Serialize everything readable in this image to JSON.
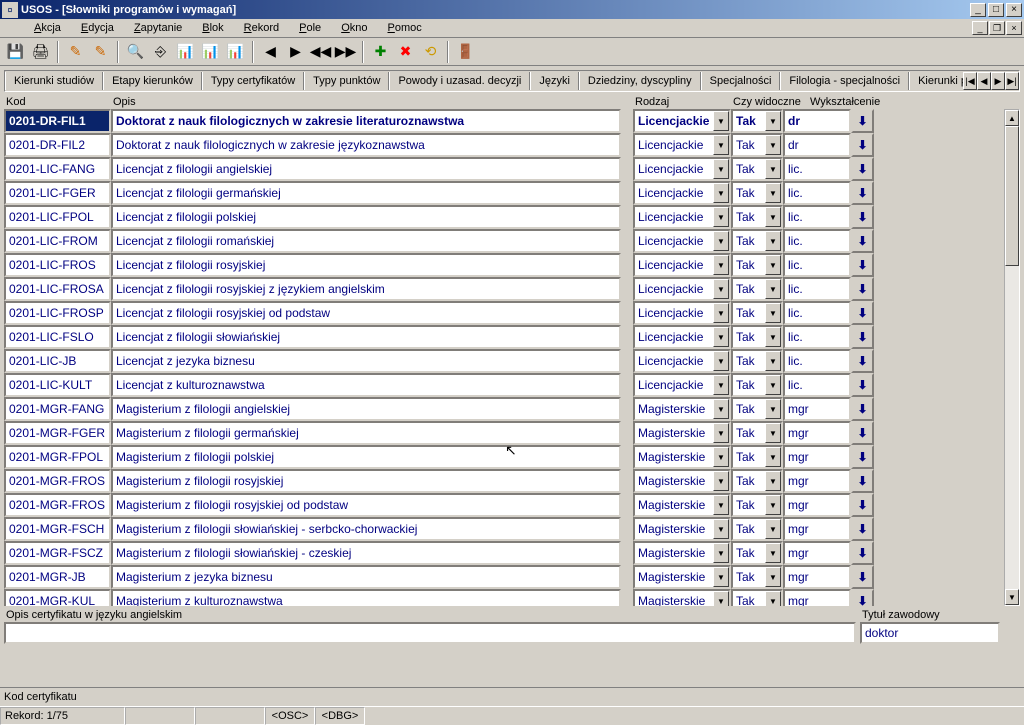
{
  "window": {
    "title": "USOS - [Słowniki programów i wymagań]"
  },
  "menu": {
    "items": [
      "Akcja",
      "Edycja",
      "Zapytanie",
      "Blok",
      "Rekord",
      "Pole",
      "Okno",
      "Pomoc"
    ]
  },
  "tabs": {
    "items": [
      "Kierunki studiów",
      "Etapy kierunków",
      "Typy certyfikatów",
      "Typy punktów",
      "Powody i uzasad. decyzji",
      "Języki",
      "Dziedziny, dyscypliny",
      "Specjalności",
      "Filologia - specjalności",
      "Kierunki pr"
    ],
    "active_index": 2
  },
  "columns": {
    "kod": "Kod",
    "opis": "Opis",
    "rodzaj": "Rodzaj",
    "czy": "Czy widoczne",
    "wyk": "Wykształcenie"
  },
  "rows": [
    {
      "kod": "0201-DR-FIL1",
      "opis": "Doktorat z nauk filologicznych w zakresie literaturoznawstwa",
      "rodzaj": "Licencjackie",
      "czy": "Tak",
      "wyk": "dr",
      "selected": true,
      "bold": true
    },
    {
      "kod": "0201-DR-FIL2",
      "opis": "Doktorat z nauk filologicznych w zakresie językoznawstwa",
      "rodzaj": "Licencjackie",
      "czy": "Tak",
      "wyk": "dr"
    },
    {
      "kod": "0201-LIC-FANG",
      "opis": "Licencjat z filologii angielskiej",
      "rodzaj": "Licencjackie",
      "czy": "Tak",
      "wyk": "lic."
    },
    {
      "kod": "0201-LIC-FGER",
      "opis": "Licencjat z filologii germańskiej",
      "rodzaj": "Licencjackie",
      "czy": "Tak",
      "wyk": "lic."
    },
    {
      "kod": "0201-LIC-FPOL",
      "opis": "Licencjat z filologii polskiej",
      "rodzaj": "Licencjackie",
      "czy": "Tak",
      "wyk": "lic."
    },
    {
      "kod": "0201-LIC-FROM",
      "opis": "Licencjat z filologii romańskiej",
      "rodzaj": "Licencjackie",
      "czy": "Tak",
      "wyk": "lic."
    },
    {
      "kod": "0201-LIC-FROS",
      "opis": "Licencjat z filologii rosyjskiej",
      "rodzaj": "Licencjackie",
      "czy": "Tak",
      "wyk": "lic."
    },
    {
      "kod": "0201-LIC-FROSA",
      "opis": "Licencjat z filologii rosyjskiej z językiem angielskim",
      "rodzaj": "Licencjackie",
      "czy": "Tak",
      "wyk": "lic."
    },
    {
      "kod": "0201-LIC-FROSP",
      "opis": "Licencjat z filologii rosyjskiej od podstaw",
      "rodzaj": "Licencjackie",
      "czy": "Tak",
      "wyk": "lic."
    },
    {
      "kod": "0201-LIC-FSLO",
      "opis": "Licencjat z filologii słowiańskiej",
      "rodzaj": "Licencjackie",
      "czy": "Tak",
      "wyk": "lic."
    },
    {
      "kod": "0201-LIC-JB",
      "opis": "Licencjat z jezyka biznesu",
      "rodzaj": "Licencjackie",
      "czy": "Tak",
      "wyk": "lic."
    },
    {
      "kod": "0201-LIC-KULT",
      "opis": "Licencjat z kulturoznawstwa",
      "rodzaj": "Licencjackie",
      "czy": "Tak",
      "wyk": "lic."
    },
    {
      "kod": "0201-MGR-FANG",
      "opis": "Magisterium z filologii angielskiej",
      "rodzaj": "Magisterskie",
      "czy": "Tak",
      "wyk": "mgr"
    },
    {
      "kod": "0201-MGR-FGER",
      "opis": "Magisterium z filologii germańskiej",
      "rodzaj": "Magisterskie",
      "czy": "Tak",
      "wyk": "mgr"
    },
    {
      "kod": "0201-MGR-FPOL",
      "opis": "Magisterium z filologii polskiej",
      "rodzaj": "Magisterskie",
      "czy": "Tak",
      "wyk": "mgr"
    },
    {
      "kod": "0201-MGR-FROS",
      "opis": "Magisterium z filologii rosyjskiej",
      "rodzaj": "Magisterskie",
      "czy": "Tak",
      "wyk": "mgr"
    },
    {
      "kod": "0201-MGR-FROS",
      "opis": "Magisterium z filologii rosyjskiej od podstaw",
      "rodzaj": "Magisterskie",
      "czy": "Tak",
      "wyk": "mgr"
    },
    {
      "kod": "0201-MGR-FSCH",
      "opis": "Magisterium z filologii słowiańskiej - serbcko-chorwackiej",
      "rodzaj": "Magisterskie",
      "czy": "Tak",
      "wyk": "mgr"
    },
    {
      "kod": "0201-MGR-FSCZ",
      "opis": "Magisterium z filologii słowiańskiej - czeskiej",
      "rodzaj": "Magisterskie",
      "czy": "Tak",
      "wyk": "mgr"
    },
    {
      "kod": "0201-MGR-JB",
      "opis": "Magisterium z jezyka biznesu",
      "rodzaj": "Magisterskie",
      "czy": "Tak",
      "wyk": "mgr"
    },
    {
      "kod": "0201-MGR-KUL",
      "opis": "Magisterium z kulturoznawstwa",
      "rodzaj": "Magisterskie",
      "czy": "Tak",
      "wyk": "mgr"
    }
  ],
  "bottom": {
    "opis_label": "Opis certyfikatu w języku angielskim",
    "opis_value": "",
    "tytul_label": "Tytuł zawodowy",
    "tytul_value": "doktor"
  },
  "status": {
    "hint": "Kod certyfikatu",
    "rekord": "Rekord: 1/75",
    "osc": "<OSC>",
    "dbg": "<DBG>"
  }
}
